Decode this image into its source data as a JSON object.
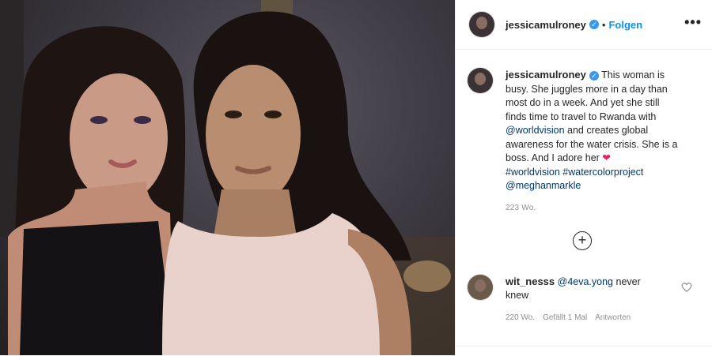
{
  "post": {
    "username": "jessicamulroney",
    "follow_label": "Folgen",
    "more_label": "•••",
    "separator": "•"
  },
  "caption": {
    "username": "jessicamulroney",
    "text_1": " This woman is busy. She juggles more in a day than most do in a week. And yet she still finds time to travel to Rwanda with ",
    "mention_1": "@worldvision",
    "text_2": " and creates global awareness for the water crisis. She is a boss. And I adore her ",
    "heart": "❤",
    "hashtag_1": "#worldvision",
    "hashtag_2": "#watercolorproject",
    "mention_2": "@meghanmarkle",
    "time": "223 Wo."
  },
  "load_more_icon": "plus-circle-icon",
  "comment": {
    "username": "wit_nesss",
    "mention": "@4eva.yong",
    "text": " never knew",
    "time": "220 Wo.",
    "likes": "Gefällt 1 Mal",
    "reply_label": "Antworten"
  },
  "colors": {
    "link": "#00376b",
    "follow": "#0095f6",
    "verified": "#3897f0",
    "heart": "#e0245e",
    "meta": "#8e8e8e"
  }
}
